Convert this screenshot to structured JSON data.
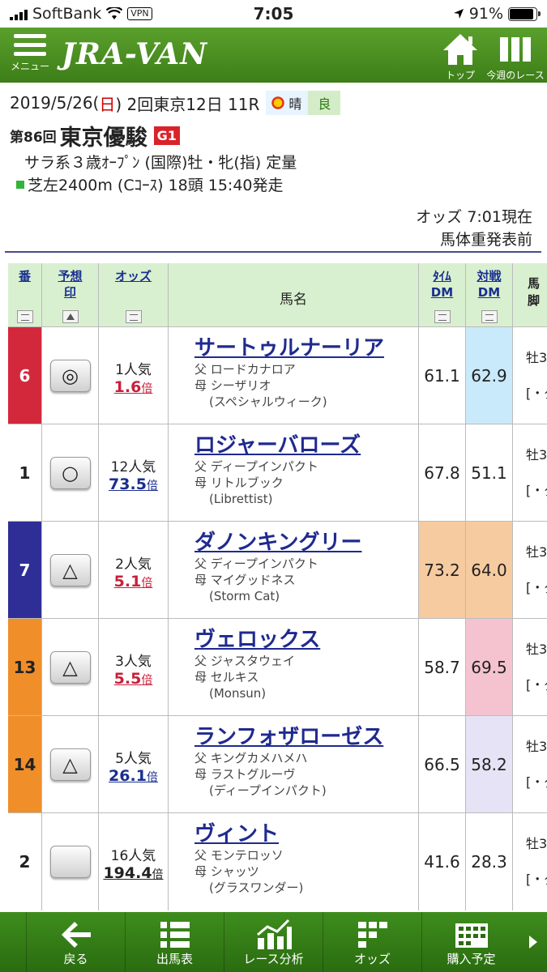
{
  "status": {
    "carrier": "SoftBank",
    "vpn": "VPN",
    "time": "7:05",
    "battery": "91%",
    "battery_level": 0.91
  },
  "header": {
    "menu_label": "メニュー",
    "logo": "JRA-VAN",
    "top_label": "トップ",
    "week_label": "今週のレース"
  },
  "race": {
    "date_a": "2019/5/26(",
    "date_day": "日",
    "date_b": ") 2回東京12日 11R",
    "weather": "晴",
    "track": "良",
    "kai": "第86回",
    "name": "東京優駿",
    "grade": "G1",
    "conditions": "サラ系３歳ｵｰﾌﾟﾝ (国際)牡・牝(指) 定量",
    "course": "芝左2400m (Cｺｰｽ) 18頭 15:40発走",
    "odds_time": "オッズ 7:01現在",
    "weight_status": "馬体重発表前"
  },
  "table": {
    "headers": {
      "num": "番",
      "mark1": "予想",
      "mark2": "印",
      "odds": "オッズ",
      "horse": "馬名",
      "dm1a": "ﾀｲﾑ",
      "dm1b": "DM",
      "dm2a": "対戦",
      "dm2b": "DM",
      "extra1": "馬",
      "extra2": "脚"
    },
    "rows": [
      {
        "num": "6",
        "num_color": "#d3283c",
        "num_text_color": "#ffffff",
        "mark": "◎",
        "pop": "1人気",
        "odds": "1.6",
        "odds_color": "red",
        "bai": "倍",
        "name": "サートゥルナーリア",
        "sire_label": "父",
        "sire": "ロードカナロア",
        "dam_label": "母",
        "dam": "シーザリオ",
        "bms": "(スペシャルウィーク)",
        "dm1": "61.1",
        "dm1_bg": "#ffffff",
        "dm2": "62.9",
        "dm2_bg": "#c9eafb",
        "extra": "牡3",
        "extra2": "[・ダ"
      },
      {
        "num": "1",
        "num_color": "#ffffff",
        "num_text_color": "#222222",
        "mark": "○",
        "pop": "12人気",
        "odds": "73.5",
        "odds_color": "blue",
        "bai": "倍",
        "name": "ロジャーバローズ",
        "sire_label": "父",
        "sire": "ディープインパクト",
        "dam_label": "母",
        "dam": "リトルブック",
        "bms": "(Librettist)",
        "dm1": "67.8",
        "dm1_bg": "#ffffff",
        "dm2": "51.1",
        "dm2_bg": "#ffffff",
        "extra": "牡3",
        "extra2": "[・ダ"
      },
      {
        "num": "7",
        "num_color": "#2e2e96",
        "num_text_color": "#ffffff",
        "mark": "△",
        "pop": "2人気",
        "odds": "5.1",
        "odds_color": "red",
        "bai": "倍",
        "name": "ダノンキングリー",
        "sire_label": "父",
        "sire": "ディープインパクト",
        "dam_label": "母",
        "dam": "マイグッドネス",
        "bms": "(Storm Cat)",
        "dm1": "73.2",
        "dm1_bg": "#f7cba0",
        "dm2": "64.0",
        "dm2_bg": "#f7cba0",
        "extra": "牡3",
        "extra2": "[・ダ"
      },
      {
        "num": "13",
        "num_color": "#f08e2a",
        "num_text_color": "#222222",
        "mark": "△",
        "pop": "3人気",
        "odds": "5.5",
        "odds_color": "red",
        "bai": "倍",
        "name": "ヴェロックス",
        "sire_label": "父",
        "sire": "ジャスタウェイ",
        "dam_label": "母",
        "dam": "セルキス",
        "bms": "(Monsun)",
        "dm1": "58.7",
        "dm1_bg": "#ffffff",
        "dm2": "69.5",
        "dm2_bg": "#f5c3cf",
        "extra": "牡3",
        "extra2": "[・ダ"
      },
      {
        "num": "14",
        "num_color": "#f08e2a",
        "num_text_color": "#222222",
        "mark": "△",
        "pop": "5人気",
        "odds": "26.1",
        "odds_color": "blue",
        "bai": "倍",
        "name": "ランフォザローゼス",
        "sire_label": "父",
        "sire": "キングカメハメハ",
        "dam_label": "母",
        "dam": "ラストグルーヴ",
        "bms": "(ディープインパクト)",
        "dm1": "66.5",
        "dm1_bg": "#ffffff",
        "dm2": "58.2",
        "dm2_bg": "#e5e3f5",
        "extra": "牡3",
        "extra2": "[・ダ"
      },
      {
        "num": "2",
        "num_color": "#ffffff",
        "num_text_color": "#222222",
        "mark": "",
        "pop": "16人気",
        "odds": "194.4",
        "odds_color": "black",
        "bai": "倍",
        "name": "ヴィント",
        "sire_label": "父",
        "sire": "モンテロッソ",
        "dam_label": "母",
        "dam": "シャッツ",
        "bms": "(グラスワンダー)",
        "dm1": "41.6",
        "dm1_bg": "#ffffff",
        "dm2": "28.3",
        "dm2_bg": "#ffffff",
        "extra": "牡3",
        "extra2": "[・ダ"
      }
    ]
  },
  "bottom_nav": [
    {
      "label": "戻る",
      "icon": "back-arrow-icon"
    },
    {
      "label": "出馬表",
      "icon": "list-icon"
    },
    {
      "label": "レース分析",
      "icon": "chart-icon"
    },
    {
      "label": "オッズ",
      "icon": "grid-icon"
    },
    {
      "label": "購入予定",
      "icon": "calendar-icon"
    }
  ]
}
